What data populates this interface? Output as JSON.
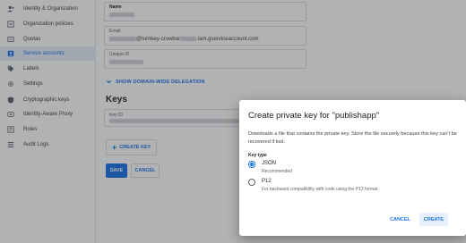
{
  "sidebar": {
    "items": [
      {
        "label": "Identity & Organization",
        "icon": "person-plus-icon"
      },
      {
        "label": "Organization policies",
        "icon": "policy-list-icon"
      },
      {
        "label": "Quotas",
        "icon": "quota-icon"
      },
      {
        "label": "Service accounts",
        "icon": "service-account-icon",
        "active": true
      },
      {
        "label": "Labels",
        "icon": "tag-icon"
      },
      {
        "label": "Settings",
        "icon": "gear-icon"
      },
      {
        "label": "Cryptographic keys",
        "icon": "shield-icon"
      },
      {
        "label": "Identity-Aware Proxy",
        "icon": "proxy-icon"
      },
      {
        "label": "Roles",
        "icon": "roles-icon"
      },
      {
        "label": "Audit Logs",
        "icon": "list-icon"
      }
    ]
  },
  "form": {
    "name_label": "Name",
    "email_label": "Email",
    "email_value_prefix": "@turnkey-crowbar",
    "email_value_suffix": ".iam.gserviceaccount.com",
    "unique_id_label": "Unique ID",
    "domain_wide_label": "SHOW DOMAIN-WIDE DELEGATION",
    "keys_title": "Keys",
    "key_id_label": "Key ID",
    "create_key_label": "CREATE KEY",
    "save_label": "SAVE",
    "cancel_label": "CANCEL"
  },
  "dialog": {
    "title": "Create private key for \"publishapp\"",
    "description": "Downloads a file that contains the private key. Store the file securely because this key can't be recovered if lost.",
    "key_type_label": "Key type",
    "options": [
      {
        "label": "JSON",
        "sub": "Recommended",
        "checked": true
      },
      {
        "label": "P12",
        "sub": "For backward compatibility with code using the P12 format",
        "checked": false
      }
    ],
    "cancel_label": "CANCEL",
    "create_label": "CREATE"
  },
  "colors": {
    "accent": "#1a73e8",
    "active_bg": "#e8f0fe",
    "overlay": "rgba(32,33,36,0.35)"
  }
}
